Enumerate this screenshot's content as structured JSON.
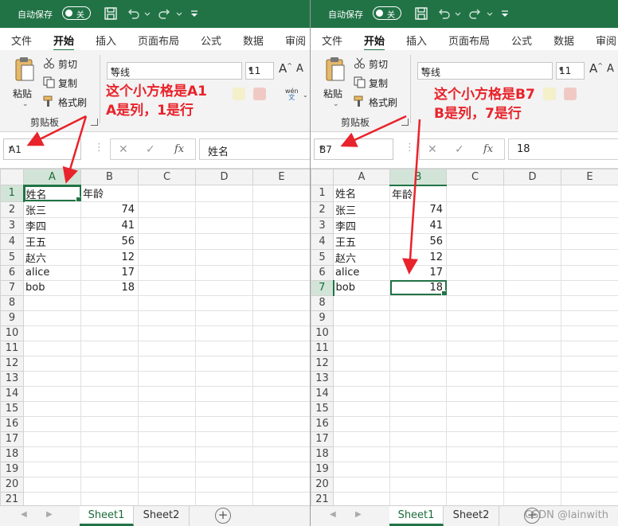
{
  "autosave_label": "自动保存",
  "toggle_label": "关",
  "tabs": [
    "文件",
    "开始",
    "插入",
    "页面布局",
    "公式",
    "数据",
    "审阅"
  ],
  "clipboard": {
    "paste": "粘贴",
    "cut": "剪切",
    "copy": "复制",
    "format_painter": "格式刷",
    "group": "剪贴板"
  },
  "font": {
    "name": "等线",
    "size": "11"
  },
  "columns": [
    "A",
    "B",
    "C",
    "D",
    "E"
  ],
  "rows": [
    "1",
    "2",
    "3",
    "4",
    "5",
    "6",
    "7",
    "8",
    "9",
    "10",
    "11",
    "12",
    "13",
    "14",
    "15",
    "16",
    "17",
    "18",
    "19",
    "20",
    "21"
  ],
  "data_rows": [
    [
      "姓名",
      "年龄"
    ],
    [
      "张三",
      "74"
    ],
    [
      "李四",
      "41"
    ],
    [
      "王五",
      "56"
    ],
    [
      "赵六",
      "12"
    ],
    [
      "alice",
      "17"
    ],
    [
      "bob",
      "18"
    ]
  ],
  "sheets": [
    "Sheet1",
    "Sheet2"
  ],
  "left": {
    "namebox": "A1",
    "formula": "姓名",
    "annotation_line1": "这个小方格是A1",
    "annotation_line2": "A是列，1是行"
  },
  "right": {
    "namebox": "B7",
    "formula": "18",
    "annotation_line1": "这个小方格是B7",
    "annotation_line2": "B是列，7是行"
  },
  "watermark": "CSDN @lainwith",
  "colors": {
    "excel_green": "#217346",
    "annotation_red": "#e8232b"
  },
  "icons": [
    "save-icon",
    "undo-icon",
    "redo-icon",
    "customize-icon",
    "paste-icon",
    "cut-icon",
    "copy-icon",
    "format-painter-icon",
    "cancel-icon",
    "enter-icon",
    "fx-icon",
    "add-sheet-icon"
  ]
}
